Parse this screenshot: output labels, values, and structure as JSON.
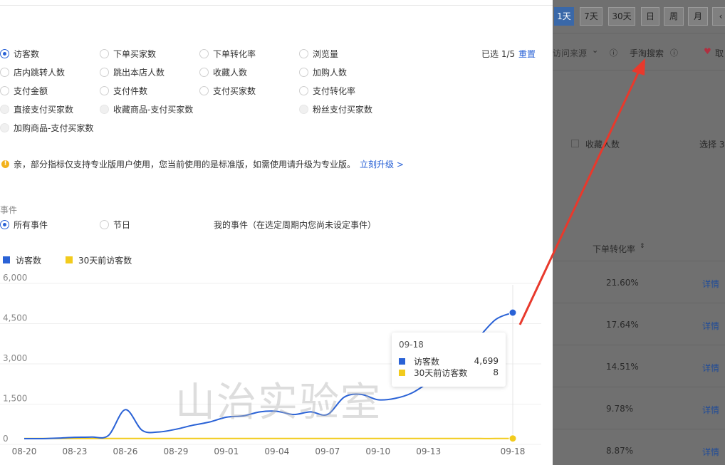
{
  "metrics": [
    {
      "label": "访客数",
      "state": "on"
    },
    {
      "label": "下单买家数",
      "state": "off"
    },
    {
      "label": "下单转化率",
      "state": "off"
    },
    {
      "label": "浏览量",
      "state": "off"
    },
    {
      "label": "店内跳转人数",
      "state": "off"
    },
    {
      "label": "跳出本店人数",
      "state": "off"
    },
    {
      "label": "收藏人数",
      "state": "off"
    },
    {
      "label": "加购人数",
      "state": "off"
    },
    {
      "label": "支付金额",
      "state": "off"
    },
    {
      "label": "支付件数",
      "state": "off"
    },
    {
      "label": "支付买家数",
      "state": "off"
    },
    {
      "label": "支付转化率",
      "state": "off"
    },
    {
      "label": "直接支付买家数",
      "state": "disabled"
    },
    {
      "label": "收藏商品-支付买家数",
      "state": "disabled"
    },
    {
      "label": "粉丝支付买家数",
      "state": "disabled"
    },
    {
      "label": "加购商品-支付买家数",
      "state": "disabled"
    }
  ],
  "selection": {
    "count_text": "已选 1/5",
    "reset_label": "重置"
  },
  "notice": {
    "icon": "!",
    "text": "亲，部分指标仅支持专业版用户使用，您当前使用的是标准版，如需使用请升级为专业版。",
    "upgrade_label": "立刻升级 >"
  },
  "events": {
    "title": "事件",
    "options": [
      {
        "label": "所有事件",
        "state": "on"
      },
      {
        "label": "节日",
        "state": "off"
      },
      {
        "label": "我的事件（在选定周期内您尚未设定事件）",
        "state": "none"
      }
    ]
  },
  "chart_data": {
    "type": "line",
    "x": [
      "08-20",
      "08-21",
      "08-22",
      "08-23",
      "08-24",
      "08-25",
      "08-26",
      "08-27",
      "08-28",
      "08-29",
      "08-30",
      "08-31",
      "09-01",
      "09-02",
      "09-03",
      "09-04",
      "09-05",
      "09-06",
      "09-07",
      "09-08",
      "09-09",
      "09-10",
      "09-11",
      "09-12",
      "09-13",
      "09-14",
      "09-15",
      "09-16",
      "09-17",
      "09-18"
    ],
    "xticks": [
      "08-20",
      "08-23",
      "08-26",
      "08-29",
      "09-01",
      "09-04",
      "09-07",
      "09-10",
      "09-13",
      "09-18"
    ],
    "yticks": [
      "0",
      "1,500",
      "3,000",
      "4,500",
      "6,000"
    ],
    "ylim": [
      0,
      6000
    ],
    "series": [
      {
        "name": "访客数",
        "color": "#2a62d6",
        "values": [
          0,
          0,
          20,
          50,
          60,
          120,
          1080,
          310,
          250,
          350,
          500,
          620,
          800,
          850,
          1000,
          1020,
          900,
          1000,
          900,
          1550,
          1650,
          1450,
          1500,
          1700,
          2100,
          2600,
          3200,
          3800,
          4450,
          4699
        ]
      },
      {
        "name": "30天前访客数",
        "color": "#f2cb1d",
        "values": [
          5,
          5,
          5,
          5,
          5,
          5,
          5,
          5,
          5,
          5,
          5,
          5,
          5,
          5,
          5,
          5,
          5,
          5,
          5,
          5,
          5,
          5,
          5,
          5,
          5,
          5,
          5,
          5,
          5,
          8
        ]
      }
    ],
    "tooltip": {
      "date": "09-18",
      "rows": [
        {
          "name": "访客数",
          "value": "4,699"
        },
        {
          "name": "30天前访客数",
          "value": "8"
        }
      ]
    }
  },
  "watermark": "山治实验室",
  "background": {
    "period_tabs": [
      {
        "label": "1天",
        "active": true
      },
      {
        "label": "7天",
        "active": false
      },
      {
        "label": "30天",
        "active": false
      },
      {
        "label": "日",
        "active": false
      },
      {
        "label": "周",
        "active": false
      },
      {
        "label": "月",
        "active": false
      }
    ],
    "source_dropdown": "访问来源",
    "search_label": "手淘搜索",
    "fav_label": "取",
    "checkbox_label": "收藏人数",
    "select_label": "选择 3",
    "column_header": "下单转化率",
    "rows": [
      {
        "rate": "21.60%",
        "link": "详情"
      },
      {
        "rate": "17.64%",
        "link": "详情"
      },
      {
        "rate": "14.51%",
        "link": "详情"
      },
      {
        "rate": "9.78%",
        "link": "详情"
      },
      {
        "rate": "8.87%",
        "link": "详情"
      }
    ]
  }
}
